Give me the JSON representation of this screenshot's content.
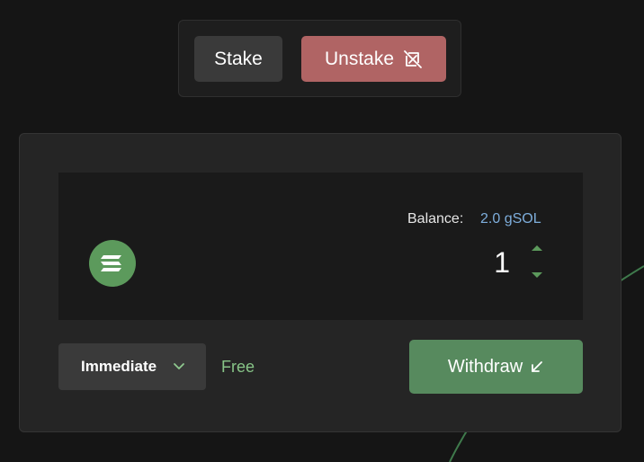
{
  "tabs": {
    "stake_label": "Stake",
    "unstake_label": "Unstake"
  },
  "input": {
    "balance_label": "Balance:",
    "balance_value": "2.0 gSOL",
    "amount": "1"
  },
  "options": {
    "speed_selected": "Immediate",
    "fee_label": "Free"
  },
  "action": {
    "withdraw_label": "Withdraw"
  },
  "icons": {
    "unstake": "no-stake-icon",
    "token": "solana-logo-icon",
    "withdraw": "arrow-down-left-icon",
    "dropdown": "chevron-down-icon"
  },
  "colors": {
    "background": "#151515",
    "unstake_tab": "#b06464",
    "accent_green": "#578a5e",
    "fee_green": "#87c487",
    "balance_blue": "#7eaedc"
  }
}
